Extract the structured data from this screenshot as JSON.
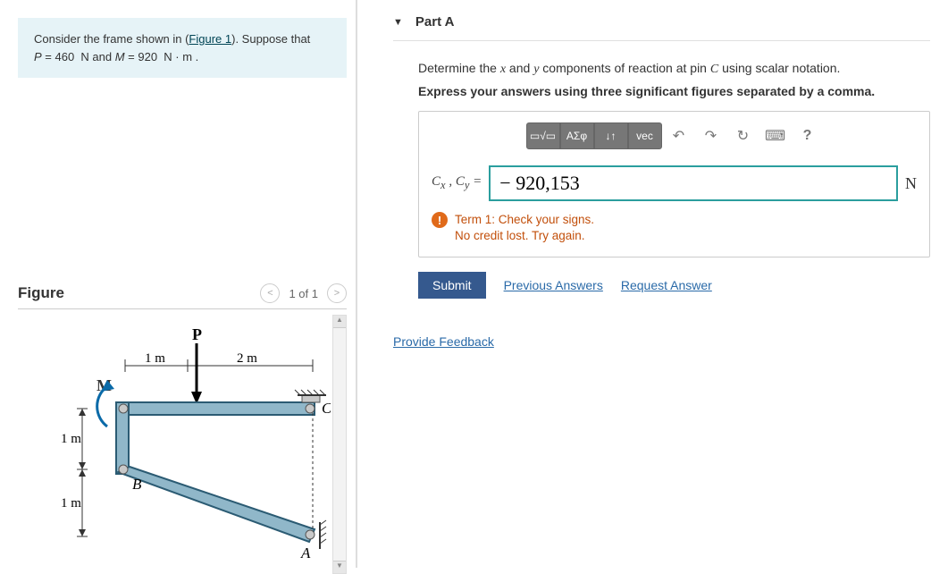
{
  "problem": {
    "intro_pre": "Consider the frame shown in (",
    "fig_link": "Figure 1",
    "intro_post": "). Suppose that ",
    "line2_html": "P = 460  N and M = 920  N · m ."
  },
  "figure": {
    "heading": "Figure",
    "pager_text": "1 of 1",
    "labels": {
      "P": "P",
      "M": "M",
      "B": "B",
      "C": "C",
      "A": "A",
      "d1m_a": "1 m",
      "d1m_b": "1 m",
      "h1m": "1 m",
      "h2m": "2 m"
    }
  },
  "part": {
    "title": "Part A",
    "prompt1_pre": "Determine the ",
    "var_x": "x",
    "prompt1_mid": " and ",
    "var_y": "y",
    "prompt1_post": " components of reaction at pin ",
    "var_C": "C",
    "prompt1_end": " using scalar notation.",
    "prompt2": "Express your answers using three significant figures separated by a comma.",
    "toolbar": {
      "tmpl": "▭√▭",
      "greek": "ΑΣφ",
      "arrows": "↓↑",
      "vec": "vec",
      "undo": "↶",
      "redo": "↷",
      "reset": "↻",
      "keyb": "⌨",
      "help": "?"
    },
    "answer": {
      "lhs": "Cₓ , C_y  =",
      "value": "− 920,153",
      "unit": "N"
    },
    "feedback": {
      "line1": "Term 1: Check your signs.",
      "line2": "No credit lost. Try again."
    },
    "actions": {
      "submit": "Submit",
      "prev": "Previous Answers",
      "req": "Request Answer"
    }
  },
  "provide_feedback": "Provide Feedback"
}
